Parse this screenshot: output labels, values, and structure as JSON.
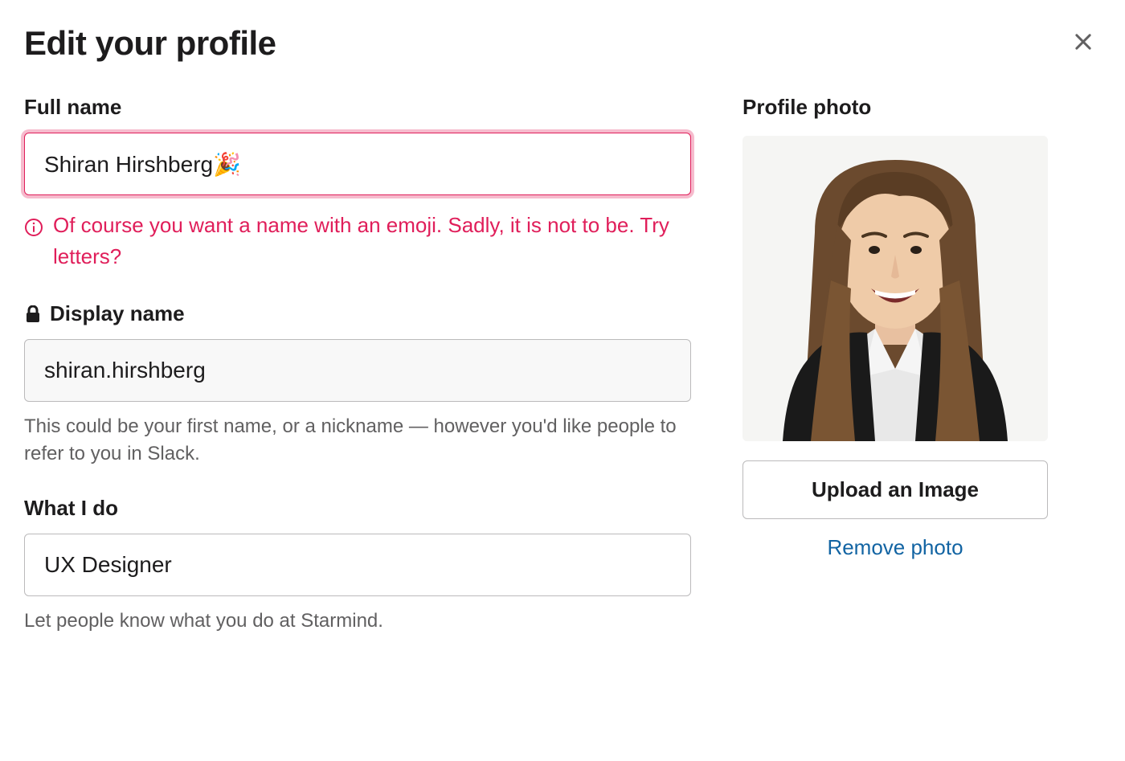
{
  "modal": {
    "title": "Edit your profile"
  },
  "fields": {
    "fullName": {
      "label": "Full name",
      "value": "Shiran Hirshberg🎉",
      "error": "Of course you want a name with an emoji. Sadly, it is not to be. Try letters?"
    },
    "displayName": {
      "label": "Display name",
      "value": "shiran.hirshberg",
      "help": "This could be your first name, or a nickname — however you'd like people to refer to you in Slack."
    },
    "whatIDo": {
      "label": "What I do",
      "value": "UX Designer",
      "help": "Let people know what you do at Starmind."
    }
  },
  "photo": {
    "label": "Profile photo",
    "uploadButton": "Upload an Image",
    "removeLink": "Remove photo"
  }
}
